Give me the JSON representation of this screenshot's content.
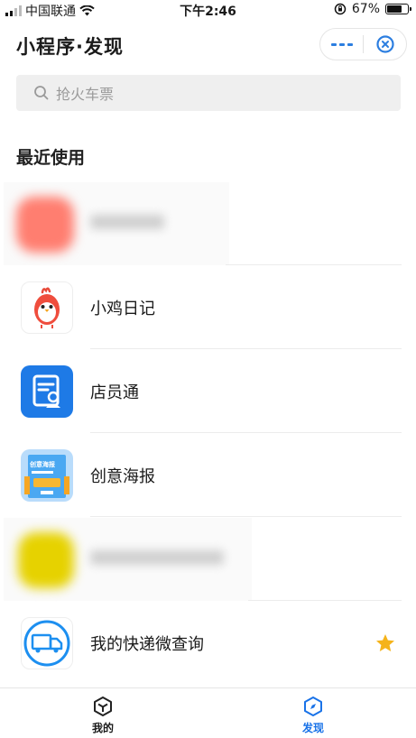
{
  "status_bar": {
    "carrier": "中国联通",
    "time": "下午2:46",
    "battery": "67%",
    "battery_level": 0.67
  },
  "header": {
    "title": "小程序·发现"
  },
  "search": {
    "placeholder": "抢火车票"
  },
  "section": {
    "title": "最近使用"
  },
  "items": [
    {
      "label": "",
      "icon": "blurred-red-app-icon"
    },
    {
      "label": "小鸡日记",
      "icon": "chick-app-icon"
    },
    {
      "label": "店员通",
      "icon": "staff-document-app-icon"
    },
    {
      "label": "创意海报",
      "icon": "poster-app-icon",
      "icon_text": "创意海报"
    },
    {
      "label": "",
      "icon": "blurred-yellow-app-icon"
    },
    {
      "label": "我的快递微查询",
      "icon": "delivery-truck-app-icon",
      "starred": true
    }
  ],
  "tabbar": {
    "tabs": [
      {
        "label": "我的"
      },
      {
        "label": "发现"
      }
    ]
  },
  "colors": {
    "accent": "#1a73e8",
    "star": "#f5b31a"
  }
}
